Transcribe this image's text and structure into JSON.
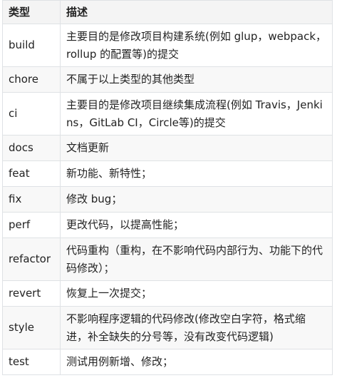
{
  "table": {
    "headers": {
      "type": "类型",
      "description": "描述"
    },
    "rows": [
      {
        "type": "build",
        "description": "主要目的是修改项目构建系统(例如 glup，webpack，rollup 的配置等)的提交"
      },
      {
        "type": "chore",
        "description": "不属于以上类型的其他类型"
      },
      {
        "type": "ci",
        "description": "主要目的是修改项目继续集成流程(例如 Travis，Jenkins，GitLab CI，Circle等)的提交"
      },
      {
        "type": "docs",
        "description": "文档更新"
      },
      {
        "type": "feat",
        "description": "新功能、新特性；"
      },
      {
        "type": "fix",
        "description": "修改 bug；"
      },
      {
        "type": "perf",
        "description": "更改代码，以提高性能；"
      },
      {
        "type": "refactor",
        "description": "代码重构（重构，在不影响代码内部行为、功能下的代码修改）；"
      },
      {
        "type": "revert",
        "description": "恢复上一次提交；"
      },
      {
        "type": "style",
        "description": "不影响程序逻辑的代码修改(修改空白字符，格式缩进，补全缺失的分号等，没有改变代码逻辑)"
      },
      {
        "type": "test",
        "description": "测试用例新增、修改；"
      }
    ]
  },
  "colors": {
    "header_background": "#f4f4f4",
    "stripe_background": "#f8f8f8",
    "border": "#dfe2e5",
    "text": "#222222"
  }
}
